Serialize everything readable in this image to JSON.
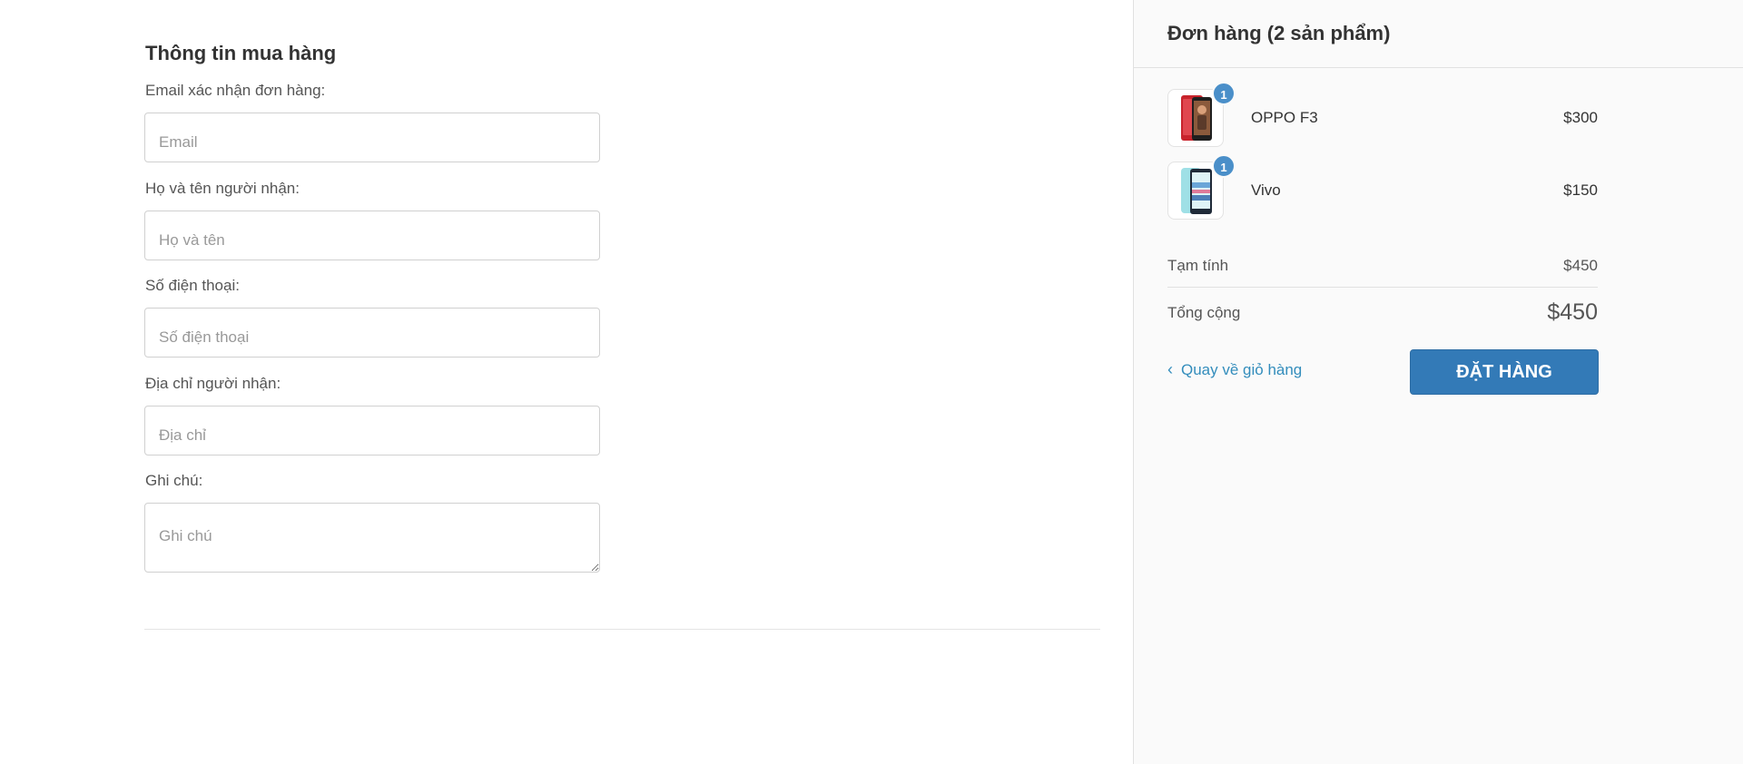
{
  "form": {
    "title": "Thông tin mua hàng",
    "fields": [
      {
        "label": "Email xác nhận đơn hàng:",
        "placeholder": "Email",
        "value": ""
      },
      {
        "label": "Họ và tên người nhận:",
        "placeholder": "Họ và tên",
        "value": ""
      },
      {
        "label": "Số điện thoại:",
        "placeholder": "Số điện thoại",
        "value": ""
      },
      {
        "label": "Địa chỉ người nhận:",
        "placeholder": "Địa chỉ",
        "value": ""
      },
      {
        "label": "Ghi chú:",
        "placeholder": "Ghi chú",
        "value": ""
      }
    ]
  },
  "order": {
    "title": "Đơn hàng (2 sản phẩm)",
    "items": [
      {
        "name": "OPPO F3",
        "price": "$300",
        "quantity": "1",
        "image": "red-phone-thumbnail",
        "image_color": "#c8232c"
      },
      {
        "name": "Vivo",
        "price": "$150",
        "quantity": "1",
        "image": "aqua-phone-thumbnail",
        "image_color": "#9fe0e6"
      }
    ],
    "subtotal_label": "Tạm tính",
    "subtotal_value": "$450",
    "total_label": "Tổng cộng",
    "total_value": "$450",
    "back_icon": "chevron-left-icon",
    "back_label": "Quay về giỏ hàng",
    "submit_label": "ĐẶT HÀNG"
  },
  "colors": {
    "accent": "#337ab7",
    "link": "#338dbc",
    "badge": "#4a8fc9",
    "sidebar_bg": "#fafafa"
  }
}
